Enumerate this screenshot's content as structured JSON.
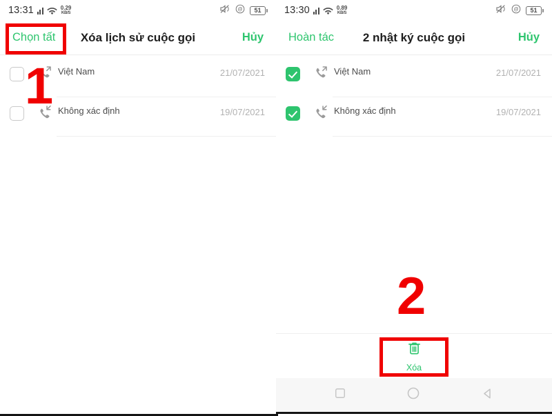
{
  "left_panel": {
    "status_bar": {
      "time": "13:31",
      "net_speed_value": "0.29",
      "net_speed_unit": "KB/S",
      "battery_level": "51",
      "icons": [
        "signal-bars-icon",
        "wifi-icon",
        "vibrate-mute-icon",
        "dnd-icon",
        "battery-icon"
      ]
    },
    "app_bar": {
      "left_action": "Chọn tất",
      "title": "Xóa lịch sử cuộc gọi",
      "right_action": "Hủy"
    },
    "calls": [
      {
        "name_blurred": true,
        "subtitle": "Việt Nam",
        "date": "21/07/2021",
        "call_type": "outgoing",
        "checked": false
      },
      {
        "name_blurred": true,
        "subtitle": "Không xác định",
        "date": "19/07/2021",
        "call_type": "incoming",
        "checked": false
      }
    ]
  },
  "right_panel": {
    "status_bar": {
      "time": "13:30",
      "net_speed_value": "0.89",
      "net_speed_unit": "KB/S",
      "battery_level": "51",
      "icons": [
        "signal-bars-icon",
        "wifi-icon",
        "vibrate-mute-icon",
        "dnd-icon",
        "battery-icon"
      ]
    },
    "app_bar": {
      "left_action": "Hoàn tác",
      "title": "2 nhật ký cuộc gọi",
      "right_action": "Hủy"
    },
    "calls": [
      {
        "name_blurred": true,
        "subtitle": "Việt Nam",
        "date": "21/07/2021",
        "call_type": "outgoing",
        "checked": true
      },
      {
        "name_blurred": true,
        "subtitle": "Không xác định",
        "date": "19/07/2021",
        "call_type": "incoming",
        "checked": true
      }
    ],
    "bottom_bar": {
      "delete_label": "Xóa",
      "delete_icon": "trash-icon"
    },
    "nav_bar": {
      "recents": "square-icon",
      "home": "circle-icon",
      "back": "triangle-back-icon"
    }
  },
  "annotations": {
    "step_one": "1",
    "step_two": "2",
    "color": "#f00000"
  },
  "colors": {
    "accent_green": "#2ec46e",
    "text_primary": "#1d1d1d",
    "text_muted": "#b2b2b2",
    "annotation_red": "#f00000"
  }
}
